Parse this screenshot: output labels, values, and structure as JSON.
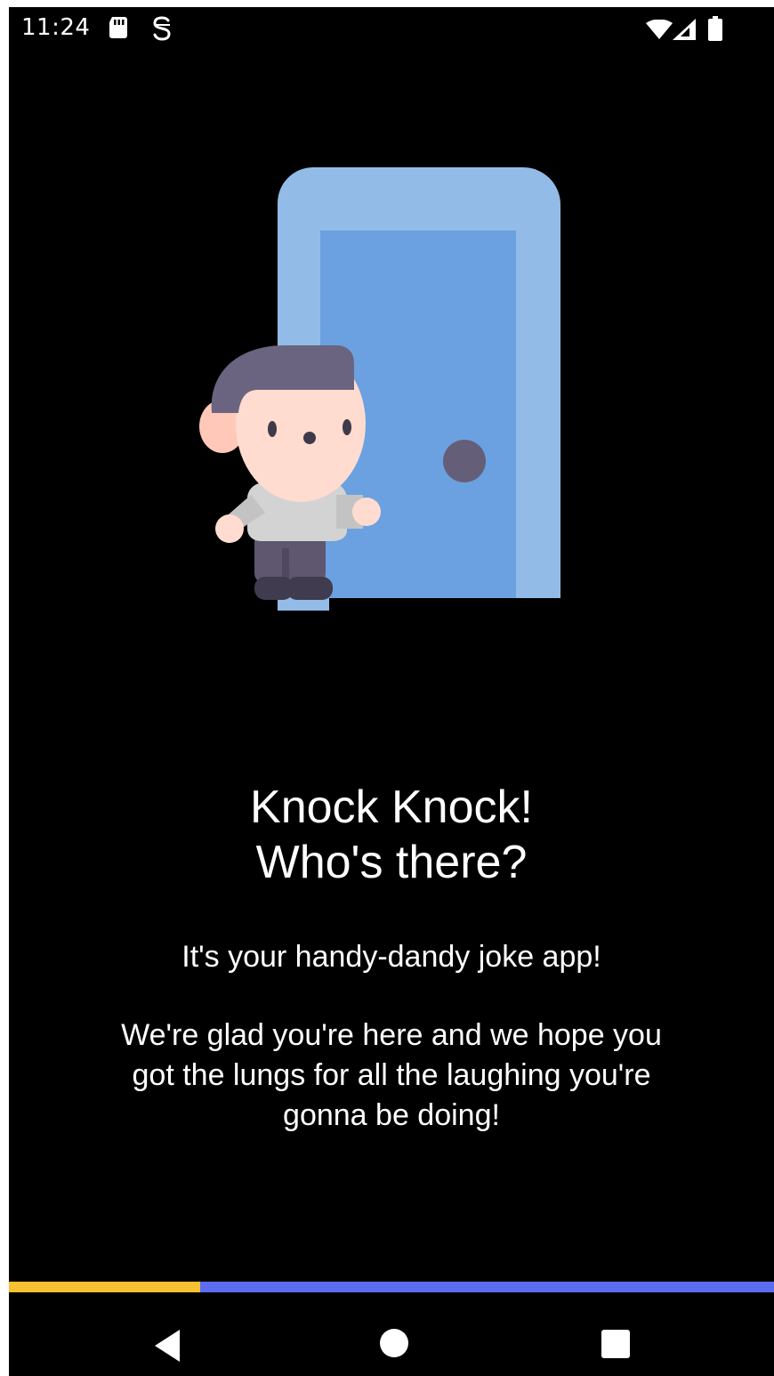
{
  "status_bar": {
    "time": "11:24",
    "icons": [
      "sd-card-icon",
      "s-app-icon",
      "wifi-icon",
      "signal-icon",
      "battery-icon"
    ]
  },
  "illustration": {
    "name": "boy-at-door",
    "colors": {
      "door_frame": "#93bbe8",
      "door_panel": "#6ba1e0",
      "door_knob": "#655e79",
      "hair": "#6b6480",
      "skin": "#ffdccf",
      "ear": "#ffc8b8",
      "shirt": "#d3d3d3",
      "pants": "#5e576f",
      "shoes": "#403b4e"
    }
  },
  "onboarding": {
    "headline_line1": "Knock Knock!",
    "headline_line2": "Who's there?",
    "subtitle": "It's your handy-dandy joke app!",
    "paragraph": "We're glad you're here and we hope you got the lungs for all the laughing you're gonna be doing!"
  },
  "progress": {
    "fraction": 0.25,
    "fill_color": "#f8c132",
    "track_color": "#5c6df0"
  },
  "nav_bar": {
    "icons": [
      "back-icon",
      "home-icon",
      "recents-icon"
    ]
  }
}
